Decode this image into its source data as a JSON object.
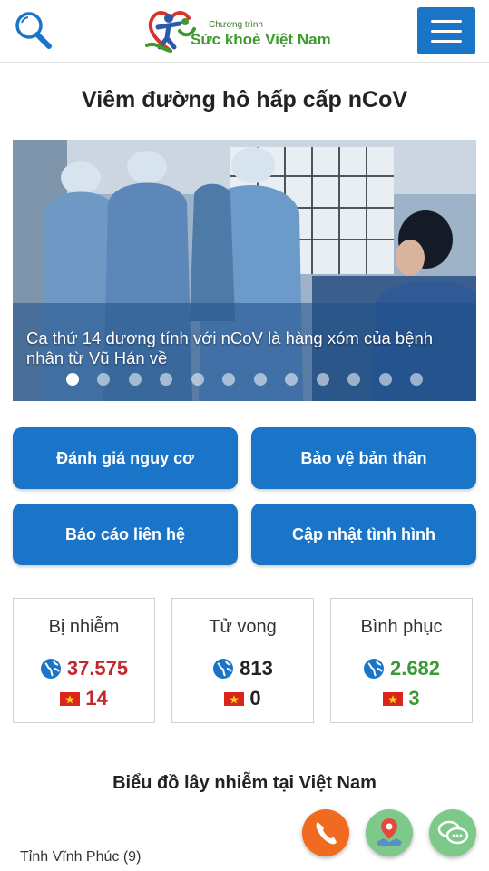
{
  "header": {
    "logo_small": "Chương trình",
    "logo_main": "Sức khoẻ Việt Nam",
    "search_icon": "search-icon",
    "menu_icon": "hamburger-menu-icon"
  },
  "page_title": "Viêm đường hô hấp cấp nCoV",
  "banner": {
    "caption": "Ca thứ 14 dương tính với nCoV là hàng xóm của bệnh nhân từ Vũ Hán về",
    "slide_count": 12,
    "active_slide": 1
  },
  "actions": {
    "risk": "Đánh giá nguy cơ",
    "protect": "Bảo vệ bản thân",
    "report": "Báo cáo liên hệ",
    "update": "Cập nhật tình hình"
  },
  "stats": {
    "infected": {
      "label": "Bị nhiễm",
      "world": "37.575",
      "vietnam": "14",
      "color": "#c0282d"
    },
    "deaths": {
      "label": "Tử vong",
      "world": "813",
      "vietnam": "0",
      "color": "#222222"
    },
    "recovered": {
      "label": "Bình phục",
      "world": "2.682",
      "vietnam": "3",
      "color": "#3a9a37"
    }
  },
  "chart_section": {
    "title": "Biểu đồ lây nhiễm tại Việt Nam",
    "first_row": "Tỉnh Vĩnh Phúc (9)"
  },
  "fabs": {
    "phone_color": "#f06a1f",
    "map_color": "#7cc98a",
    "chat_color": "#7cc98a"
  }
}
